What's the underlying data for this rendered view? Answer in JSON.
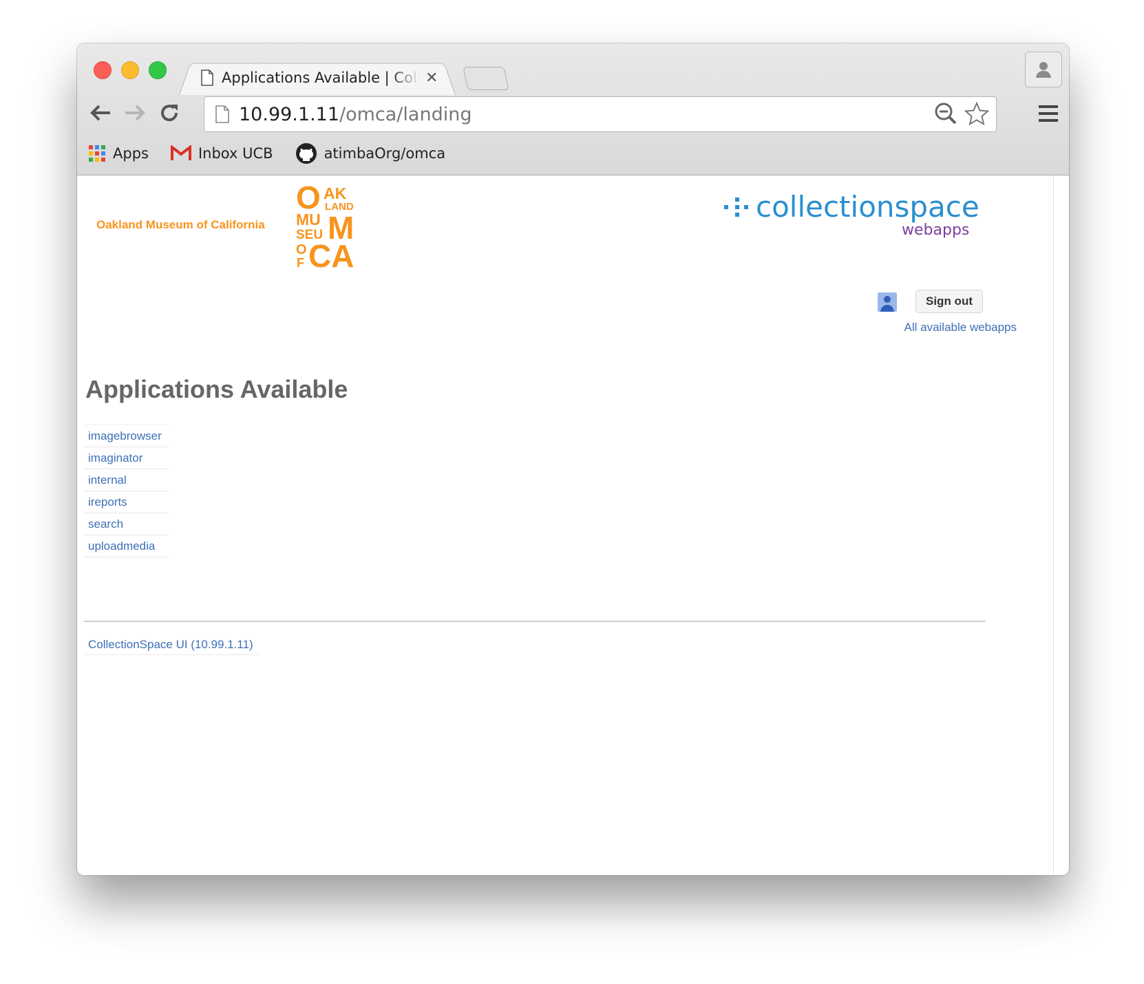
{
  "browser": {
    "tab_title": "Applications Available | CollectionSpace",
    "url_host": "10.99.1.11",
    "url_path": "/omca/landing",
    "bookmarks": [
      {
        "label": "Apps",
        "icon": "apps-grid-icon"
      },
      {
        "label": "Inbox UCB",
        "icon": "gmail-icon"
      },
      {
        "label": "atimbaOrg/omca",
        "icon": "github-icon"
      }
    ]
  },
  "header": {
    "org_name": "Oakland Museum of California",
    "logo_letters": [
      "O",
      "AK",
      "LAND",
      "MU",
      "SEU",
      "M",
      "O",
      "F",
      "CA"
    ],
    "brand_main": "collectionspace",
    "brand_sub": "webapps",
    "sign_out": "Sign out",
    "all_webapps": "All available webapps"
  },
  "main": {
    "title": "Applications Available",
    "apps": [
      "imagebrowser",
      "imaginator",
      "internal",
      "ireports",
      "search",
      "uploadmedia"
    ]
  },
  "footer": {
    "link": "CollectionSpace UI (10.99.1.11)"
  },
  "colors": {
    "link": "#3d6fb6",
    "omca_orange": "#f7941d",
    "cspace_blue": "#2a8fd0",
    "webapps_purple": "#7b3f9e"
  }
}
